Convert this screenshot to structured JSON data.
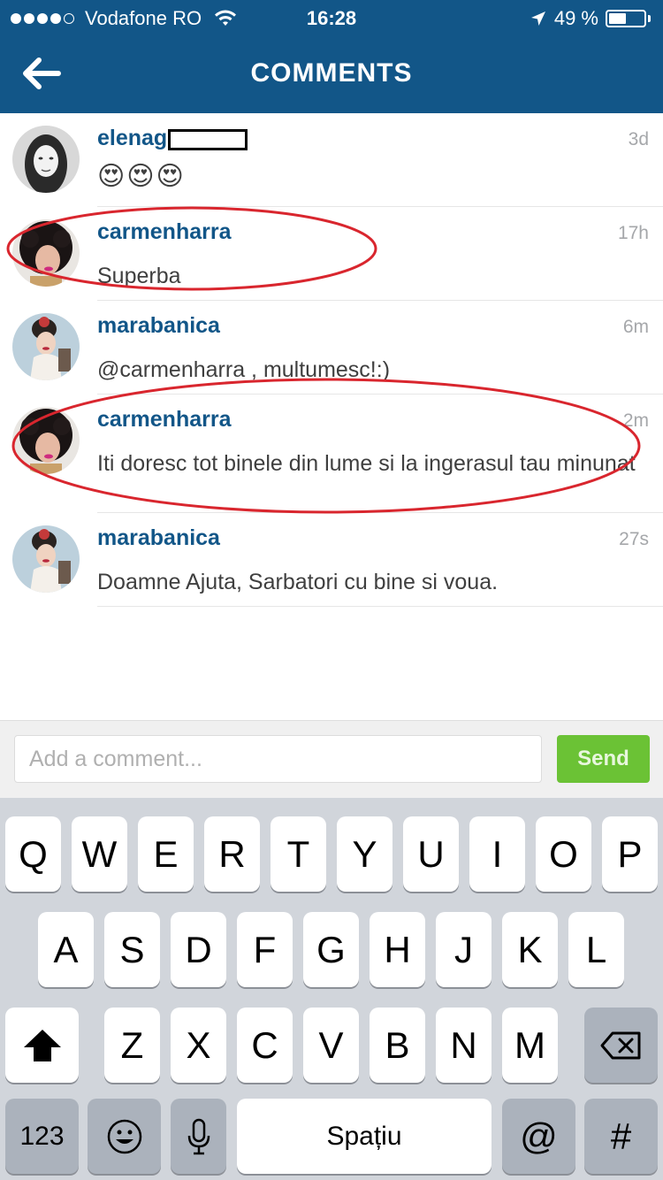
{
  "status_bar": {
    "carrier": "Vodafone RO",
    "time": "16:28",
    "battery": "49 %",
    "battery_level": 0.49,
    "signal_bars": 4
  },
  "nav": {
    "title": "COMMENTS"
  },
  "comments": [
    {
      "username": "elenag",
      "time": "3d",
      "text": "😍😍😍"
    },
    {
      "username": "carmenharra",
      "time": "17h",
      "text": "Superba"
    },
    {
      "username": "marabanica",
      "time": "6m",
      "text": "@carmenharra , multumesc!:)"
    },
    {
      "username": "carmenharra",
      "time": "2m",
      "text": "Iti doresc tot binele din lume si la ingerasul tau minunat"
    },
    {
      "username": "marabanica",
      "time": "27s",
      "text": "Doamne Ajuta, Sarbatori cu bine si voua."
    }
  ],
  "composer": {
    "placeholder": "Add a comment...",
    "value": "",
    "send_label": "Send"
  },
  "keyboard": {
    "row1": [
      "Q",
      "W",
      "E",
      "R",
      "T",
      "Y",
      "U",
      "I",
      "O",
      "P"
    ],
    "row2": [
      "A",
      "S",
      "D",
      "F",
      "G",
      "H",
      "J",
      "K",
      "L"
    ],
    "row3": [
      "Z",
      "X",
      "C",
      "V",
      "B",
      "N",
      "M"
    ],
    "numbers_label": "123",
    "space_label": "Spațiu",
    "at_label": "@",
    "hash_label": "#"
  },
  "colors": {
    "header": "#125688",
    "username": "#125688",
    "send_button": "#6bc235",
    "highlight_ellipse": "#d9262e"
  }
}
